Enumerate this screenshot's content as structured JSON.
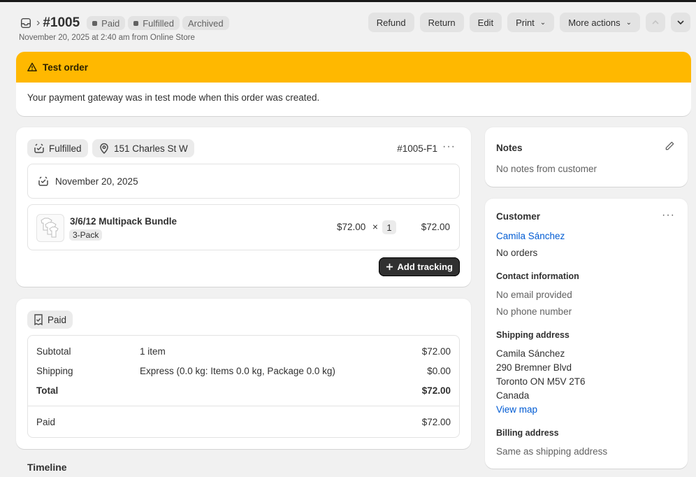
{
  "header": {
    "order_number": "#1005",
    "badges": [
      "Paid",
      "Fulfilled",
      "Archived"
    ],
    "subtitle": "November 20, 2025 at 2:40 am from Online Store",
    "actions": [
      "Refund",
      "Return",
      "Edit",
      "Print",
      "More actions"
    ]
  },
  "banner": {
    "title": "Test order",
    "message": "Your payment gateway was in test mode when this order was created.",
    "color": "#ffb800"
  },
  "fulfillment": {
    "status": "Fulfilled",
    "location": "151 Charles St W",
    "id": "#1005-F1",
    "date": "November 20, 2025",
    "item": {
      "name": "3/6/12 Multipack Bundle",
      "variant": "3-Pack",
      "unit_price": "$72.00",
      "times": "×",
      "quantity": "1",
      "total": "$72.00"
    },
    "add_tracking": "Add tracking"
  },
  "payment": {
    "status": "Paid",
    "rows": [
      {
        "label": "Subtotal",
        "detail": "1 item",
        "amount": "$72.00"
      },
      {
        "label": "Shipping",
        "detail": "Express (0.0 kg: Items 0.0 kg, Package 0.0 kg)",
        "amount": "$0.00"
      },
      {
        "label": "Total",
        "detail": "",
        "amount": "$72.00"
      }
    ],
    "paid": {
      "label": "Paid",
      "amount": "$72.00"
    }
  },
  "timeline": {
    "title": "Timeline"
  },
  "notes": {
    "title": "Notes",
    "text": "No notes from customer"
  },
  "customer": {
    "title": "Customer",
    "name": "Camila Sánchez",
    "orders": "No orders",
    "contact_title": "Contact information",
    "email": "No email provided",
    "phone": "No phone number",
    "shipping_title": "Shipping address",
    "shipping": [
      "Camila Sánchez",
      "290 Bremner Blvd",
      "Toronto ON M5V 2T6",
      "Canada"
    ],
    "view_map": "View map",
    "billing_title": "Billing address",
    "billing": "Same as shipping address"
  }
}
